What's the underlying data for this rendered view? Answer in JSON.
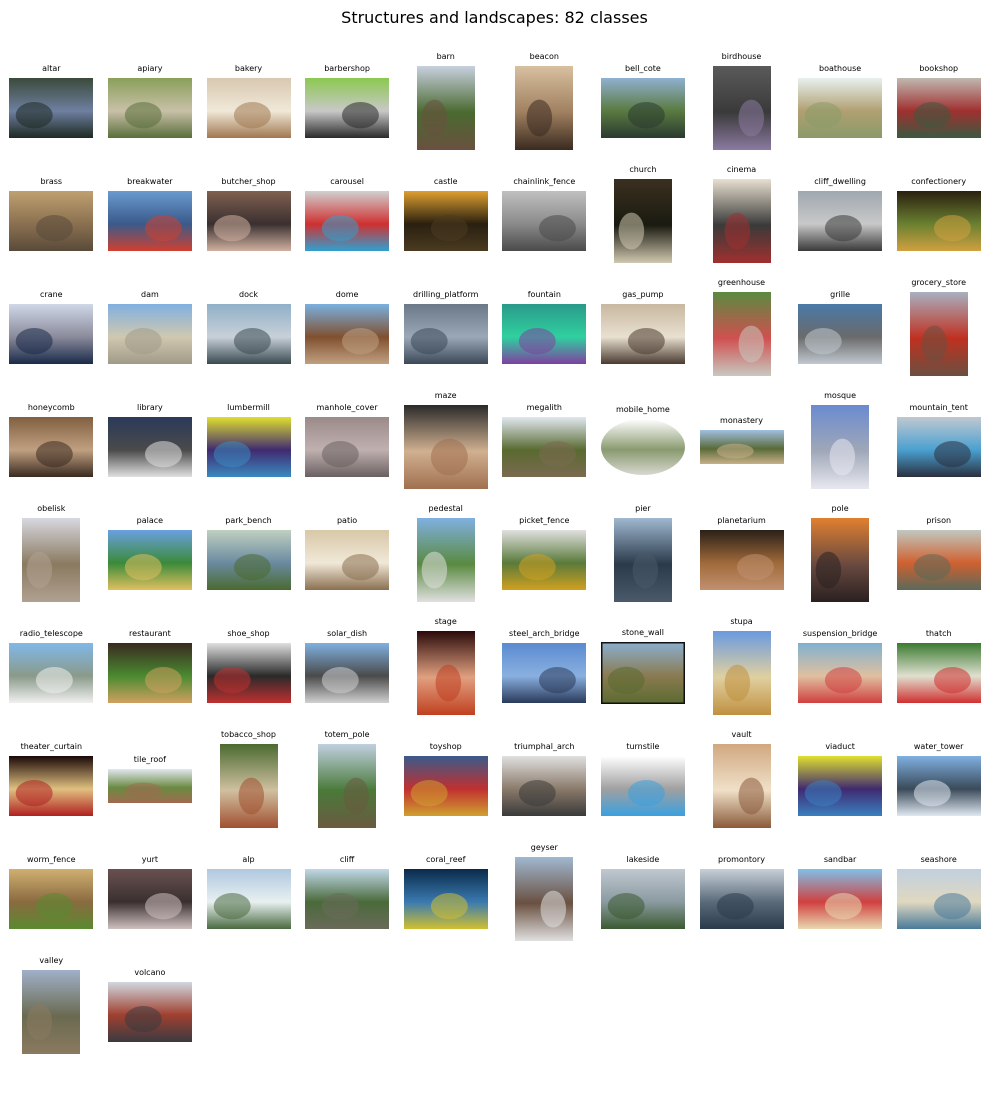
{
  "title": "Structures and landscapes: 82 classes",
  "thumbnails": [
    {
      "label": "altar",
      "colors": [
        "#3b4a3a",
        "#1e2a22",
        "#6e7fa0"
      ],
      "shape": "landscape"
    },
    {
      "label": "apiary",
      "colors": [
        "#8aa05a",
        "#5a6e3a",
        "#c8c0a8"
      ],
      "shape": "landscape"
    },
    {
      "label": "bakery",
      "colors": [
        "#d8c8b0",
        "#a07850",
        "#f0e8d8"
      ],
      "shape": "landscape"
    },
    {
      "label": "barbershop",
      "colors": [
        "#8cc850",
        "#2a2a2a",
        "#c8c8c8"
      ],
      "shape": "landscape"
    },
    {
      "label": "barn",
      "colors": [
        "#c8d0e0",
        "#6a5040",
        "#4a6a30"
      ],
      "shape": "portrait"
    },
    {
      "label": "beacon",
      "colors": [
        "#d8c0a0",
        "#3a2a20",
        "#a08060"
      ],
      "shape": "portrait"
    },
    {
      "label": "bell_cote",
      "colors": [
        "#90b0d0",
        "#2a3a30",
        "#5a7a40"
      ],
      "shape": "landscape"
    },
    {
      "label": "birdhouse",
      "colors": [
        "#5a5a5a",
        "#8a7aa0",
        "#3a3a3a"
      ],
      "shape": "portrait"
    },
    {
      "label": "boathouse",
      "colors": [
        "#e8f0f0",
        "#8a9a6a",
        "#b0a070"
      ],
      "shape": "landscape"
    },
    {
      "label": "bookshop",
      "colors": [
        "#c0b8b0",
        "#3a5a40",
        "#a03030"
      ],
      "shape": "landscape"
    },
    {
      "label": "brass",
      "colors": [
        "#c0a070",
        "#5a4a3a",
        "#8a7050"
      ],
      "shape": "landscape"
    },
    {
      "label": "breakwater",
      "colors": [
        "#6a9ad0",
        "#d04030",
        "#3a5a8a"
      ],
      "shape": "landscape"
    },
    {
      "label": "butcher_shop",
      "colors": [
        "#806050",
        "#d0b0a0",
        "#3a3030"
      ],
      "shape": "landscape"
    },
    {
      "label": "carousel",
      "colors": [
        "#d0d0d0",
        "#30a0d0",
        "#d03030"
      ],
      "shape": "landscape"
    },
    {
      "label": "castle",
      "colors": [
        "#e0a030",
        "#4a3a20",
        "#2a2010"
      ],
      "shape": "landscape"
    },
    {
      "label": "chainlink_fence",
      "colors": [
        "#c0c0c0",
        "#4a4a4a",
        "#8a8a8a"
      ],
      "shape": "landscape"
    },
    {
      "label": "church",
      "colors": [
        "#3a3020",
        "#d0c8b0",
        "#1a1a10"
      ],
      "shape": "portrait"
    },
    {
      "label": "cinema",
      "colors": [
        "#e8e0d0",
        "#a03030",
        "#3a3a3a"
      ],
      "shape": "portrait"
    },
    {
      "label": "cliff_dwelling",
      "colors": [
        "#a0a8b0",
        "#3a3a3a",
        "#c8c8c8"
      ],
      "shape": "landscape"
    },
    {
      "label": "confectionery",
      "colors": [
        "#2a2010",
        "#d0a040",
        "#6a8030"
      ],
      "shape": "landscape"
    },
    {
      "label": "crane",
      "colors": [
        "#d0d8e8",
        "#1a2a4a",
        "#8a8a9a"
      ],
      "shape": "landscape"
    },
    {
      "label": "dam",
      "colors": [
        "#80b0e0",
        "#a09a88",
        "#d0c8b0"
      ],
      "shape": "landscape"
    },
    {
      "label": "dock",
      "colors": [
        "#90b0c8",
        "#3a4a50",
        "#c8d0d8"
      ],
      "shape": "landscape"
    },
    {
      "label": "dome",
      "colors": [
        "#7ab0e0",
        "#c0a080",
        "#805030"
      ],
      "shape": "landscape"
    },
    {
      "label": "drilling_platform",
      "colors": [
        "#6a7888",
        "#3a4858",
        "#9aa8b8"
      ],
      "shape": "landscape"
    },
    {
      "label": "fountain",
      "colors": [
        "#2a9a8a",
        "#8040a0",
        "#30d0a0"
      ],
      "shape": "landscape"
    },
    {
      "label": "gas_pump",
      "colors": [
        "#c8b8a0",
        "#4a3a30",
        "#e8e0d0"
      ],
      "shape": "landscape"
    },
    {
      "label": "greenhouse",
      "colors": [
        "#5a8a40",
        "#c8c8c0",
        "#d05050"
      ],
      "shape": "portrait"
    },
    {
      "label": "grille",
      "colors": [
        "#4a7aa8",
        "#c0c8d0",
        "#6a6a6a"
      ],
      "shape": "landscape"
    },
    {
      "label": "grocery_store",
      "colors": [
        "#a8b0c0",
        "#6a5040",
        "#c03020"
      ],
      "shape": "portrait"
    },
    {
      "label": "honeycomb",
      "colors": [
        "#806040",
        "#3a2a20",
        "#c0a080"
      ],
      "shape": "landscape"
    },
    {
      "label": "library",
      "colors": [
        "#2a3a5a",
        "#e0e0e0",
        "#4a4a4a"
      ],
      "shape": "landscape"
    },
    {
      "label": "lumbermill",
      "colors": [
        "#e0e030",
        "#3a8ac0",
        "#402a70"
      ],
      "shape": "landscape"
    },
    {
      "label": "manhole_cover",
      "colors": [
        "#9a8a88",
        "#6a6060",
        "#c0b0b0"
      ],
      "shape": "landscape"
    },
    {
      "label": "maze",
      "colors": [
        "#2a2a2a",
        "#a07050",
        "#d0b090"
      ],
      "shape": "square"
    },
    {
      "label": "megalith",
      "colors": [
        "#e0e8f0",
        "#7a6a50",
        "#5a6a30"
      ],
      "shape": "landscape"
    },
    {
      "label": "mobile_home",
      "colors": [
        "#ffffff",
        "#d8d8d0",
        "#8a9a70"
      ],
      "shape": "oval"
    },
    {
      "label": "monastery",
      "colors": [
        "#a0c0e0",
        "#c8b088",
        "#5a6a3a"
      ],
      "shape": "landscape-short"
    },
    {
      "label": "mosque",
      "colors": [
        "#6a8ad0",
        "#e8e8f0",
        "#a0a8b8"
      ],
      "shape": "portrait"
    },
    {
      "label": "mountain_tent",
      "colors": [
        "#c0c8d0",
        "#2a3040",
        "#4aa0d0"
      ],
      "shape": "landscape"
    },
    {
      "label": "obelisk",
      "colors": [
        "#d8d8e0",
        "#b0a090",
        "#8a7a60"
      ],
      "shape": "portrait"
    },
    {
      "label": "palace",
      "colors": [
        "#6aa0e0",
        "#e0c060",
        "#3a8a3a"
      ],
      "shape": "landscape"
    },
    {
      "label": "park_bench",
      "colors": [
        "#c0d0c0",
        "#4a6a30",
        "#6a8aa0"
      ],
      "shape": "landscape"
    },
    {
      "label": "patio",
      "colors": [
        "#d8c8a8",
        "#8a7050",
        "#f0e8d8"
      ],
      "shape": "landscape"
    },
    {
      "label": "pedestal",
      "colors": [
        "#80b0e0",
        "#e0e0e0",
        "#5a8a40"
      ],
      "shape": "portrait"
    },
    {
      "label": "picket_fence",
      "colors": [
        "#e0e0e0",
        "#d0a020",
        "#5a7a3a"
      ],
      "shape": "landscape"
    },
    {
      "label": "pier",
      "colors": [
        "#a0b8d0",
        "#4a5a6a",
        "#2a3a4a"
      ],
      "shape": "portrait"
    },
    {
      "label": "planetarium",
      "colors": [
        "#2a2018",
        "#c09070",
        "#a06a3a"
      ],
      "shape": "landscape"
    },
    {
      "label": "pole",
      "colors": [
        "#e08030",
        "#2a2020",
        "#6a4a40"
      ],
      "shape": "portrait"
    },
    {
      "label": "prison",
      "colors": [
        "#c0c8c0",
        "#5a6a5a",
        "#d06030"
      ],
      "shape": "landscape"
    },
    {
      "label": "radio_telescope",
      "colors": [
        "#80b8e8",
        "#f0f0f0",
        "#8a9a8a"
      ],
      "shape": "landscape"
    },
    {
      "label": "restaurant",
      "colors": [
        "#3a2a20",
        "#d0a060",
        "#4a8a30"
      ],
      "shape": "landscape"
    },
    {
      "label": "shoe_shop",
      "colors": [
        "#e0e0e0",
        "#c03030",
        "#2a2a2a"
      ],
      "shape": "landscape"
    },
    {
      "label": "solar_dish",
      "colors": [
        "#80b0e0",
        "#d0d0d0",
        "#4a4a4a"
      ],
      "shape": "landscape"
    },
    {
      "label": "stage",
      "colors": [
        "#2a0a0a",
        "#c04020",
        "#e0a080"
      ],
      "shape": "portrait"
    },
    {
      "label": "steel_arch_bridge",
      "colors": [
        "#5a8ad0",
        "#2a3a5a",
        "#8ab0e0"
      ],
      "shape": "landscape"
    },
    {
      "label": "stone_wall",
      "colors": [
        "#8ab0d0",
        "#5a6a30",
        "#8a7a50"
      ],
      "shape": "landscape-border"
    },
    {
      "label": "stupa",
      "colors": [
        "#6a9ae0",
        "#c09040",
        "#e0d0a0"
      ],
      "shape": "portrait"
    },
    {
      "label": "suspension_bridge",
      "colors": [
        "#80b0d0",
        "#d04040",
        "#e0c0a0"
      ],
      "shape": "landscape"
    },
    {
      "label": "thatch",
      "colors": [
        "#3a7a30",
        "#d03030",
        "#e0e0d0"
      ],
      "shape": "landscape"
    },
    {
      "label": "theater_curtain",
      "colors": [
        "#1a0808",
        "#b02020",
        "#e0c080"
      ],
      "shape": "landscape"
    },
    {
      "label": "tile_roof",
      "colors": [
        "#e0e8f0",
        "#a06a50",
        "#6a8a40"
      ],
      "shape": "landscape-short"
    },
    {
      "label": "tobacco_shop",
      "colors": [
        "#4a6a30",
        "#a05030",
        "#d0c0a0"
      ],
      "shape": "portrait"
    },
    {
      "label": "totem_pole",
      "colors": [
        "#c0d0e0",
        "#6a5a40",
        "#4a7a3a"
      ],
      "shape": "portrait"
    },
    {
      "label": "toyshop",
      "colors": [
        "#3a5a8a",
        "#d0a030",
        "#c03030"
      ],
      "shape": "landscape"
    },
    {
      "label": "triumphal_arch",
      "colors": [
        "#e0e0e0",
        "#3a3a3a",
        "#8a7a6a"
      ],
      "shape": "landscape"
    },
    {
      "label": "turnstile",
      "colors": [
        "#ffffff",
        "#3aa0e0",
        "#a0a0a0"
      ],
      "shape": "landscape"
    },
    {
      "label": "vault",
      "colors": [
        "#d0a880",
        "#8a5a3a",
        "#f0e0c8"
      ],
      "shape": "portrait"
    },
    {
      "label": "viaduct",
      "colors": [
        "#e0e030",
        "#3a80c0",
        "#402a70"
      ],
      "shape": "landscape"
    },
    {
      "label": "water_tower",
      "colors": [
        "#80b0e0",
        "#e0e8f0",
        "#3a4a5a"
      ],
      "shape": "landscape"
    },
    {
      "label": "worm_fence",
      "colors": [
        "#d0b070",
        "#5a8a30",
        "#8a6a40"
      ],
      "shape": "landscape"
    },
    {
      "label": "yurt",
      "colors": [
        "#6a5050",
        "#d0c0c0",
        "#3a3030"
      ],
      "shape": "landscape"
    },
    {
      "label": "alp",
      "colors": [
        "#b0c8e0",
        "#4a6a40",
        "#e8f0f0"
      ],
      "shape": "landscape"
    },
    {
      "label": "cliff",
      "colors": [
        "#c0d8e8",
        "#6a6a5a",
        "#4a6a3a"
      ],
      "shape": "landscape"
    },
    {
      "label": "coral_reef",
      "colors": [
        "#0a2a4a",
        "#d0c030",
        "#3a7ab0"
      ],
      "shape": "landscape"
    },
    {
      "label": "geyser",
      "colors": [
        "#a0b8d0",
        "#e0e0e0",
        "#6a5040"
      ],
      "shape": "portrait"
    },
    {
      "label": "lakeside",
      "colors": [
        "#c0c8d0",
        "#3a5a30",
        "#8a9aa0"
      ],
      "shape": "landscape"
    },
    {
      "label": "promontory",
      "colors": [
        "#c8d0d8",
        "#2a3a4a",
        "#5a6a7a"
      ],
      "shape": "landscape"
    },
    {
      "label": "sandbar",
      "colors": [
        "#80c0e8",
        "#e8d8b0",
        "#d04040"
      ],
      "shape": "landscape"
    },
    {
      "label": "seashore",
      "colors": [
        "#c0d0e0",
        "#4a7a9a",
        "#e0d8c0"
      ],
      "shape": "landscape"
    },
    {
      "label": "valley",
      "colors": [
        "#a0b0c8",
        "#8a7a60",
        "#6a6a50"
      ],
      "shape": "portrait"
    },
    {
      "label": "volcano",
      "colors": [
        "#d0d8e0",
        "#3a3a40",
        "#a04030"
      ],
      "shape": "landscape"
    }
  ]
}
